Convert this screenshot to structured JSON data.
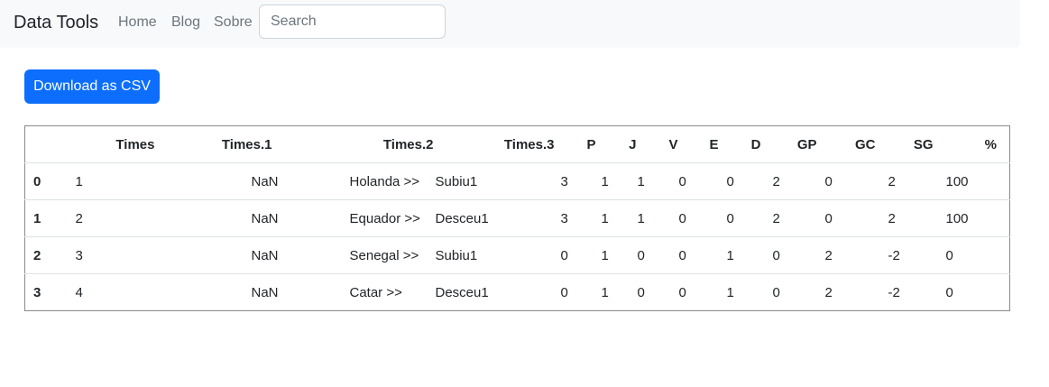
{
  "navbar": {
    "brand": "Data Tools",
    "links": [
      "Home",
      "Blog",
      "Sobre"
    ],
    "search_placeholder": "Search"
  },
  "actions": {
    "download_label": "Download as CSV"
  },
  "table": {
    "columns": [
      "",
      "Times",
      "Times.1",
      "Times.2",
      "Times.3",
      "P",
      "J",
      "V",
      "E",
      "D",
      "GP",
      "GC",
      "SG",
      "%"
    ],
    "rows": [
      {
        "index": "0",
        "cells": [
          "1",
          "NaN",
          "Holanda >>",
          "Subiu1",
          "3",
          "1",
          "1",
          "0",
          "0",
          "2",
          "0",
          "2",
          "100"
        ]
      },
      {
        "index": "1",
        "cells": [
          "2",
          "NaN",
          "Equador >>",
          "Desceu1",
          "3",
          "1",
          "1",
          "0",
          "0",
          "2",
          "0",
          "2",
          "100"
        ]
      },
      {
        "index": "2",
        "cells": [
          "3",
          "NaN",
          "Senegal >>",
          "Subiu1",
          "0",
          "1",
          "0",
          "0",
          "1",
          "0",
          "2",
          "-2",
          "0"
        ]
      },
      {
        "index": "3",
        "cells": [
          "4",
          "NaN",
          "Catar >>",
          "Desceu1",
          "0",
          "1",
          "0",
          "0",
          "1",
          "0",
          "2",
          "-2",
          "0"
        ]
      }
    ]
  }
}
